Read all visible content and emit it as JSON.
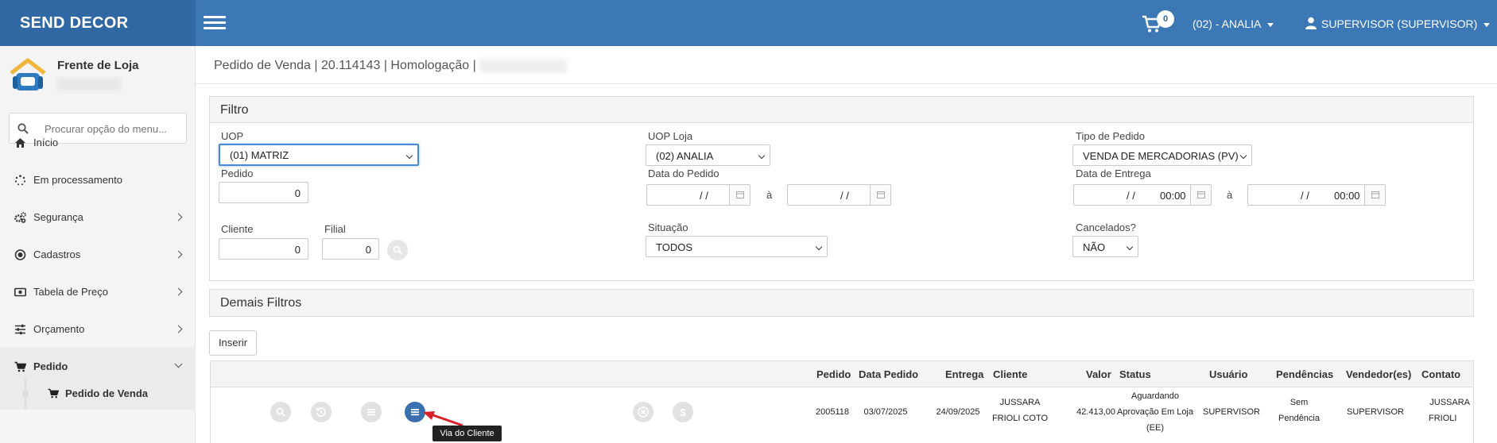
{
  "header": {
    "brand": "SEND DECOR",
    "cart_count": "0",
    "uop": "(02) - ANALIA",
    "user": "SUPERVISOR (SUPERVISOR)"
  },
  "sidebar": {
    "store_name": "Frente de Loja",
    "search_placeholder": "Procurar opção do menu...",
    "items": [
      {
        "label": "Início"
      },
      {
        "label": "Em processamento"
      },
      {
        "label": "Segurança"
      },
      {
        "label": "Cadastros"
      },
      {
        "label": "Tabela de Preço"
      },
      {
        "label": "Orçamento"
      },
      {
        "label": "Pedido"
      }
    ],
    "subitem": "Pedido de Venda"
  },
  "page": {
    "title": "Pedido de Venda | 20.114143 | Homologação | "
  },
  "filtro": {
    "title": "Filtro",
    "uop_label": "UOP",
    "uop_value": "(01) MATRIZ",
    "uop_loja_label": "UOP Loja",
    "uop_loja_value": "(02) ANALIA",
    "tipo_label": "Tipo de Pedido",
    "tipo_value": "VENDA DE MERCADORIAS (PV)",
    "pedido_label": "Pedido",
    "pedido_value": "0",
    "data_pedido_label": "Data do Pedido",
    "data_pedido_from": "/ /",
    "data_pedido_to": "/ /",
    "data_entrega_label": "Data de Entrega",
    "data_entrega_from": "/ /",
    "data_entrega_from_time": "00:00",
    "data_entrega_to": "/ /",
    "data_entrega_to_time": "00:00",
    "range_sep": "à",
    "cliente_label": "Cliente",
    "cliente_value": "0",
    "filial_label": "Filial",
    "filial_value": "0",
    "situacao_label": "Situação",
    "situacao_value": "TODOS",
    "cancelados_label": "Cancelados?",
    "cancelados_value": "NÃO"
  },
  "demais": {
    "title": "Demais Filtros"
  },
  "actions": {
    "inserir": "Inserir"
  },
  "grid": {
    "columns": [
      "Pedido",
      "Data Pedido",
      "Entrega",
      "Cliente",
      "Valor",
      "Status",
      "Usuário",
      "Pendências",
      "Vendedor(es)",
      "Contato"
    ],
    "rows": [
      {
        "pedido": "2005118",
        "data_pedido": "03/07/2025",
        "entrega": "24/09/2025",
        "cliente_l1": "JUSSARA",
        "cliente_l2": "FRIOLI COTO",
        "valor": "42.413,00",
        "status_l1": "Aguardando",
        "status_l2": "Aprovação Em Loja",
        "status_l3": "(EE)",
        "usuario": "SUPERVISOR",
        "pendencias_l1": "Sem",
        "pendencias_l2": "Pendência",
        "vendedor": "SUPERVISOR",
        "contato_l1": "JUSSARA",
        "contato_l2": "FRIOLI"
      }
    ],
    "tooltip": "Via do Cliente"
  },
  "colors": {
    "topbar": "#3c78b5",
    "brand_bg": "#2f68a3",
    "action_blue": "#3a6fb0",
    "arrow_red": "#d9202a"
  }
}
